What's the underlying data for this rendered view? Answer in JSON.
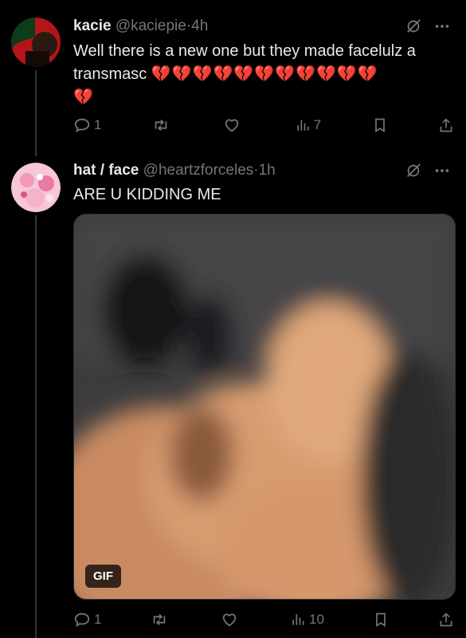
{
  "tweets": [
    {
      "display_name": "kacie",
      "handle": "@kaciepie",
      "time_sep": "·",
      "time": "4h",
      "text": "Well there is a new one but they made facelulz a transmasc",
      "hearts": "💔💔💔💔💔💔💔💔💔💔💔",
      "hearts_line2": "💔",
      "replies": "1",
      "retweets": "",
      "likes": "",
      "views": "7",
      "avatar_colors": [
        "#0b3d1a",
        "#c8181b",
        "#2b1a12"
      ]
    },
    {
      "display_name": "hat / face",
      "handle": "@heartzforceles",
      "time_sep": "·",
      "time": "1h",
      "text": "ARE U KIDDING ME",
      "media_badge": "GIF",
      "replies": "1",
      "retweets": "",
      "likes": "",
      "views": "10"
    }
  ],
  "icons": {
    "grok": "grok-icon",
    "more": "more-icon",
    "reply": "reply-icon",
    "retweet": "retweet-icon",
    "like": "like-icon",
    "views": "views-icon",
    "bookmark": "bookmark-icon",
    "share": "share-icon"
  },
  "colors": {
    "background": "#000000",
    "text": "#e7e9ea",
    "muted": "#71767b",
    "heart_red": "#e0245e"
  }
}
